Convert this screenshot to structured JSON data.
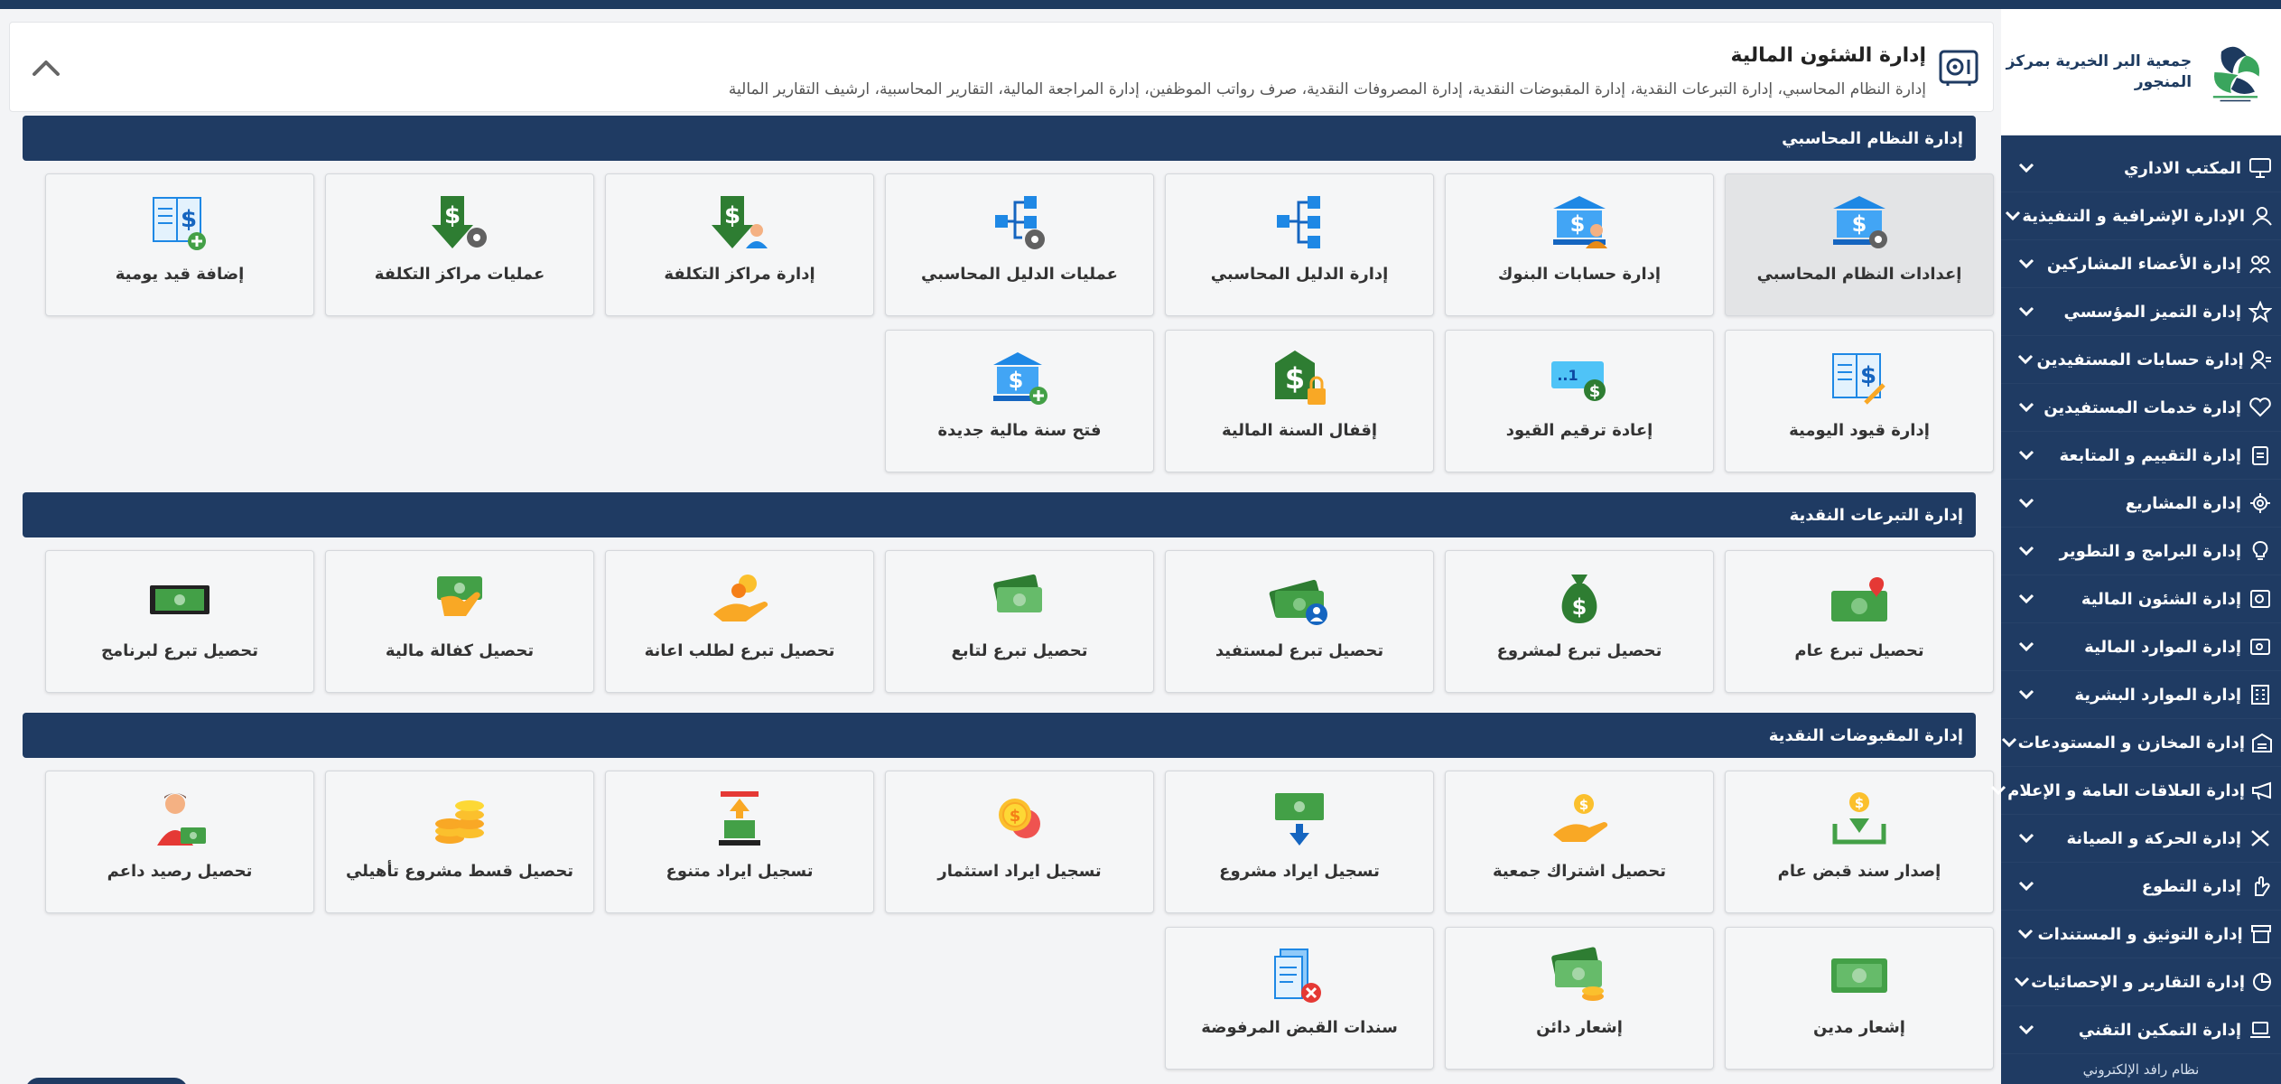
{
  "header": {
    "title": "إدارة الشئون المالية",
    "subtitle": "إدارة النظام المحاسبي، إدارة التبرعات النقدية، إدارة المقبوضات النقدية، إدارة المصروفات النقدية، صرف رواتب الموظفين، إدارة المراجعة المالية، التقارير المحاسبية، ارشيف التقارير المالية"
  },
  "sections": [
    {
      "title": "إدارة النظام المحاسبي",
      "tiles": [
        {
          "label": "إعدادات النظام المحاسبي",
          "icon": "bank-gear-icon"
        },
        {
          "label": "إدارة حسابات البنوك",
          "icon": "bank-user-icon"
        },
        {
          "label": "إدارة الدليل المحاسبي",
          "icon": "hierarchy-icon"
        },
        {
          "label": "عمليات الدليل المحاسبي",
          "icon": "hierarchy-gear-icon"
        },
        {
          "label": "إدارة مراكز التكلفة",
          "icon": "dollar-down-user-icon"
        },
        {
          "label": "عمليات مراكز التكلفة",
          "icon": "dollar-down-gear-icon"
        },
        {
          "label": "إضافة قيد يومية",
          "icon": "ledger-add-icon"
        },
        {
          "label": "إدارة قيود اليومية",
          "icon": "ledger-edit-icon"
        },
        {
          "label": "إعادة ترقيم القيود",
          "icon": "renumber-icon"
        },
        {
          "label": "إقفال السنة المالية",
          "icon": "lock-dollar-icon"
        },
        {
          "label": "فتح سنة مالية جديدة",
          "icon": "bank-add-icon"
        }
      ]
    },
    {
      "title": "إدارة التبرعات النقدية",
      "tiles": [
        {
          "label": "تحصيل تبرع عام",
          "icon": "cash-heart-icon"
        },
        {
          "label": "تحصيل تبرع لمشروع",
          "icon": "money-bag-icon"
        },
        {
          "label": "تحصيل تبرع لمستفيد",
          "icon": "cash-user-icon"
        },
        {
          "label": "تحصيل تبرع لتابع",
          "icon": "cash-stack-icon"
        },
        {
          "label": "تحصيل تبرع لطلب اعانة",
          "icon": "hand-coin-icon"
        },
        {
          "label": "تحصيل كفالة مالية",
          "icon": "hand-cash-icon"
        },
        {
          "label": "تحصيل تبرع لبرنامج",
          "icon": "cash-bill-icon"
        }
      ]
    },
    {
      "title": "إدارة المقبوضات النقدية",
      "tiles": [
        {
          "label": "إصدار سند قبض عام",
          "icon": "receipt-coin-icon"
        },
        {
          "label": "تحصيل اشتراك جمعية",
          "icon": "hand-coin-icon"
        },
        {
          "label": "تسجيل ايراد مشروع",
          "icon": "cash-down-icon"
        },
        {
          "label": "تسجيل ايراد استثمار",
          "icon": "coins-icon"
        },
        {
          "label": "تسجيل ايراد متنوع",
          "icon": "cash-up-icon"
        },
        {
          "label": "تحصيل قسط مشروع تأهيلي",
          "icon": "coin-stack-icon"
        },
        {
          "label": "تحصيل رصيد داعم",
          "icon": "person-cash-icon"
        },
        {
          "label": "إشعار مدين",
          "icon": "cash-bill-icon"
        },
        {
          "label": "إشعار دائن",
          "icon": "cash-coins-icon"
        },
        {
          "label": "سندات القبض المرفوضة",
          "icon": "receipt-rejected-icon"
        }
      ]
    }
  ],
  "sidebar": {
    "org_name": "جمعية البر الخيرية بمركز المنجور",
    "items": [
      {
        "label": "المكتب الاداري",
        "icon": "monitor-icon"
      },
      {
        "label": "الإدارة الإشرافية و التنفيذية",
        "icon": "users-icon"
      },
      {
        "label": "إدارة الأعضاء المشاركين",
        "icon": "members-icon"
      },
      {
        "label": "إدارة التميز المؤسسي",
        "icon": "star-icon"
      },
      {
        "label": "إدارة حسابات المستفيدين",
        "icon": "user-card-icon"
      },
      {
        "label": "إدارة خدمات المستفيدين",
        "icon": "heart-icon"
      },
      {
        "label": "إدارة التقييم و المتابعة",
        "icon": "clipboard-icon"
      },
      {
        "label": "إدارة المشاريع",
        "icon": "gear-icon"
      },
      {
        "label": "إدارة البرامج و التطوير",
        "icon": "lightbulb-icon"
      },
      {
        "label": "إدارة الشئون المالية",
        "icon": "safe-icon"
      },
      {
        "label": "إدارة الموارد المالية",
        "icon": "wallet-icon"
      },
      {
        "label": "إدارة الموارد البشرية",
        "icon": "building-icon"
      },
      {
        "label": "إدارة المخازن و المستودعات",
        "icon": "warehouse-icon"
      },
      {
        "label": "إدارة العلاقات العامة و الإعلام",
        "icon": "megaphone-icon"
      },
      {
        "label": "إدارة الحركة و الصيانة",
        "icon": "tools-icon"
      },
      {
        "label": "إدارة التطوع",
        "icon": "hand-icon"
      },
      {
        "label": "إدارة التوثيق و المستندات",
        "icon": "archive-icon"
      },
      {
        "label": "إدارة التقارير و الإحصائيات",
        "icon": "pie-chart-icon"
      },
      {
        "label": "إدارة التمكين التقني",
        "icon": "laptop-icon"
      }
    ],
    "footer": "نظام رافد الإلكتروني"
  }
}
